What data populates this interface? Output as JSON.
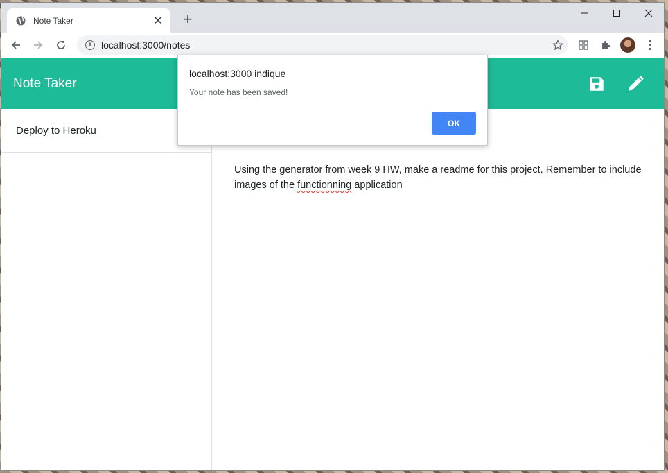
{
  "browser": {
    "tab_title": "Note Taker",
    "new_tab": "+",
    "url": "localhost:3000/notes"
  },
  "app": {
    "brand": "Note Taker",
    "accent": "#1dbb98",
    "notes": [
      {
        "title": "Deploy to Heroku"
      }
    ],
    "note_text_before": "Using the generator from week 9 HW, make a readme for this project. Remember to include images of the ",
    "note_text_misspelled": "functionning",
    "note_text_after": " application"
  },
  "dialog": {
    "title": "localhost:3000 indique",
    "message": "Your note has been saved!",
    "ok_label": "OK"
  }
}
